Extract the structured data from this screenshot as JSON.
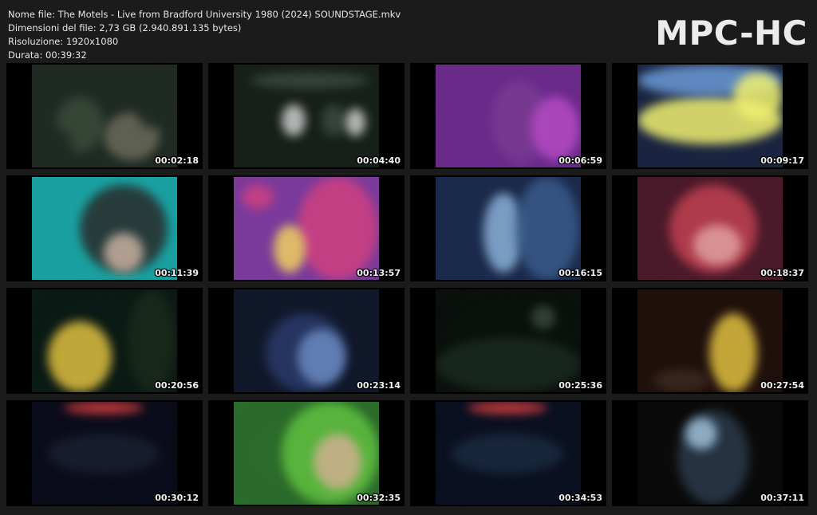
{
  "info": {
    "filename": "Nome file: The Motels - Live from Bradford University 1980 (2024) SOUNDSTAGE.mkv",
    "filesize": "Dimensioni del file: 2,73 GB (2.940.891.135 bytes)",
    "resolution": "Risoluzione: 1920x1080",
    "duration": "Durata: 00:39:32"
  },
  "logo": "MPC-HC",
  "thumbnails": [
    {
      "timestamp": "00:02:18",
      "scene": "drummer-dark-stage",
      "colors": [
        "#1e2a22",
        "#3a4a3a",
        "#6a6a5a"
      ]
    },
    {
      "timestamp": "00:04:40",
      "scene": "band-wide-shot",
      "colors": [
        "#162018",
        "#3a4a40",
        "#cfcfcf"
      ]
    },
    {
      "timestamp": "00:06:59",
      "scene": "guitarist-purple-light",
      "colors": [
        "#6a2a8a",
        "#b64ac4",
        "#d8a0c0"
      ]
    },
    {
      "timestamp": "00:09:17",
      "scene": "keyboard-closeup",
      "colors": [
        "#1a2440",
        "#6a9ad6",
        "#f0f070"
      ]
    },
    {
      "timestamp": "00:11:39",
      "scene": "singer-closeup-cyan",
      "colors": [
        "#1aa0a0",
        "#2a2a2a",
        "#c8b0a0"
      ]
    },
    {
      "timestamp": "00:13:57",
      "scene": "sax-player-lights",
      "colors": [
        "#7a3a9a",
        "#d04080",
        "#f0d060"
      ]
    },
    {
      "timestamp": "00:16:15",
      "scene": "singer-blue-curtain",
      "colors": [
        "#1a2a4a",
        "#3a5a8a",
        "#8ab0d8"
      ]
    },
    {
      "timestamp": "00:18:37",
      "scene": "singer-red-closeup",
      "colors": [
        "#4a1a2a",
        "#c04050",
        "#e0a0a0"
      ]
    },
    {
      "timestamp": "00:20:56",
      "scene": "guitarist-yellow-shirt",
      "colors": [
        "#0a1a14",
        "#1a2a1a",
        "#e0c040"
      ]
    },
    {
      "timestamp": "00:23:14",
      "scene": "singer-dancing",
      "colors": [
        "#10182a",
        "#2a3a6a",
        "#6a8ac0"
      ]
    },
    {
      "timestamp": "00:25:36",
      "scene": "audience-dark",
      "colors": [
        "#0a100c",
        "#1a2a20",
        "#3a4a3a"
      ]
    },
    {
      "timestamp": "00:27:54",
      "scene": "bassist-yellow-mic",
      "colors": [
        "#20100c",
        "#3a2a20",
        "#e0c040"
      ]
    },
    {
      "timestamp": "00:30:12",
      "scene": "wide-stage-lights",
      "colors": [
        "#0a0c1a",
        "#1a2030",
        "#e04040"
      ]
    },
    {
      "timestamp": "00:32:35",
      "scene": "singer-green-closeup",
      "colors": [
        "#2a6a2a",
        "#60c040",
        "#d0b090"
      ]
    },
    {
      "timestamp": "00:34:53",
      "scene": "wide-stage-blue",
      "colors": [
        "#0a1020",
        "#1a2a40",
        "#e04040"
      ]
    },
    {
      "timestamp": "00:37:11",
      "scene": "singer-back-view",
      "colors": [
        "#0a0a0a",
        "#2a3a4a",
        "#a0c0d8"
      ]
    }
  ]
}
